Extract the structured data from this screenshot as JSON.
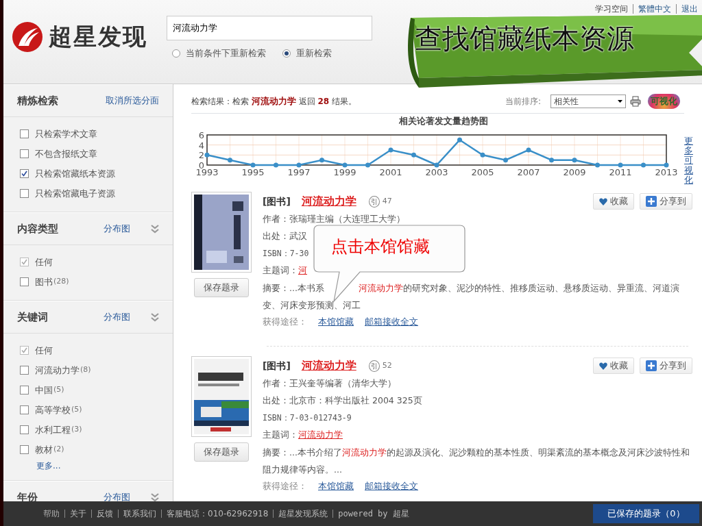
{
  "header": {
    "logo_text": "超星发现",
    "search": {
      "value": "河流动力学"
    },
    "search_options": [
      {
        "label": "当前条件下重新检索",
        "selected": false
      },
      {
        "label": "重新检索",
        "selected": true
      }
    ],
    "top_links": [
      "学习空间",
      "繁體中文",
      "退出"
    ],
    "banner": "查找馆藏纸本资源"
  },
  "sidebar": {
    "sections": [
      {
        "title": "精炼检索",
        "link": "取消所选分面",
        "options": [
          {
            "label": "只检索学术文章",
            "checked": false,
            "disabled": false
          },
          {
            "label": "不包含报纸文章",
            "checked": false,
            "disabled": false
          },
          {
            "label": "只检索馆藏纸本资源",
            "checked": true,
            "disabled": false
          },
          {
            "label": "只检索馆藏电子资源",
            "checked": false,
            "disabled": false
          }
        ]
      },
      {
        "title": "内容类型",
        "link": "分布图",
        "collapse_toggle": true,
        "options": [
          {
            "label": "任何",
            "checked": true,
            "disabled": true
          },
          {
            "label": "图书",
            "count": "(28)",
            "checked": false,
            "disabled": false
          }
        ]
      },
      {
        "title": "关键词",
        "link": "分布图",
        "collapse_toggle": true,
        "options": [
          {
            "label": "任何",
            "checked": true,
            "disabled": true
          },
          {
            "label": "河流动力学",
            "count": "(8)",
            "checked": false,
            "disabled": false
          },
          {
            "label": "中国",
            "count": "(5)",
            "checked": false,
            "disabled": false
          },
          {
            "label": "高等学校",
            "count": "(5)",
            "checked": false,
            "disabled": false
          },
          {
            "label": "水利工程",
            "count": "(3)",
            "checked": false,
            "disabled": false
          },
          {
            "label": "教材",
            "count": "(2)",
            "checked": false,
            "disabled": false
          }
        ],
        "more": "更多..."
      },
      {
        "title": "年份",
        "link": "分布图",
        "collapse_toggle": true
      }
    ]
  },
  "results_header": {
    "prefix": "检索结果：检索",
    "query": "河流动力学",
    "middle": "返回",
    "count": "28",
    "suffix": "结果。",
    "sort_label": "当前排序:",
    "sort_value": "相关性",
    "visualize": "可视化"
  },
  "trend": {
    "title": "相关论著发文量趋势图",
    "more": "更多可视化",
    "chart_data": {
      "type": "line",
      "x": [
        1993,
        1994,
        1995,
        1996,
        1997,
        1998,
        1999,
        2000,
        2001,
        2002,
        2003,
        2004,
        2005,
        2006,
        2007,
        2008,
        2009,
        2010,
        2011,
        2012,
        2013
      ],
      "grid": true,
      "series": [
        {
          "color": "#3a8fc8",
          "marker": true,
          "values": [
            2,
            1,
            0,
            0,
            0,
            1,
            0,
            0,
            3,
            2,
            0,
            5,
            2,
            1,
            3,
            1,
            1,
            0,
            0,
            0,
            0
          ]
        }
      ],
      "xticks": [
        1993,
        1995,
        1997,
        1999,
        2001,
        2003,
        2005,
        2007,
        2009,
        2011,
        2013
      ],
      "yticks": [
        0,
        2,
        4,
        6
      ],
      "ylim": [
        0,
        6
      ],
      "xlim": [
        1993,
        2013
      ]
    }
  },
  "results": [
    {
      "type_tag": "[图书]",
      "title": "河流动力学",
      "cite_icon": "引",
      "cite": "47",
      "author": "作者：张瑞瑾主编（大连理工大学）",
      "source": "出处：武汉",
      "isbn": "ISBN：7-30",
      "subject_label": "主题词：",
      "subject": "河",
      "abstract_prefix": "摘要：...本书系",
      "abstract_keyword": "河流动力学",
      "abstract_suffix": "的研究对象、泥沙的特性、推移质运动、悬移质运动、异重流、河道演变、河床变形预测、河工",
      "access_label": "获得途径：",
      "access_links": [
        "本馆馆藏",
        "邮箱接收全文"
      ],
      "save": "保存题录",
      "favorite": "收藏",
      "share": "分享到",
      "callout": "点击本馆馆藏"
    },
    {
      "type_tag": "[图书]",
      "title": "河流动力学",
      "cite_icon": "引",
      "cite": "52",
      "author": "作者：王兴奎等编著（清华大学）",
      "source": "出处：北京市：科学出版社 2004 325页",
      "isbn": "ISBN：7-03-012743-9",
      "subject_label": "主题词：",
      "subject": "河流动力学",
      "abstract_prefix": "摘要：...本书介绍了",
      "abstract_keyword": "河流动力学",
      "abstract_suffix": "的起源及演化、泥沙颗粒的基本性质、明渠紊流的基本概念及河床沙波特性和阻力规律等内容。...",
      "access_label": "获得途径：",
      "access_links": [
        "本馆馆藏",
        "邮箱接收全文"
      ],
      "save": "保存题录",
      "favorite": "收藏",
      "share": "分享到"
    }
  ],
  "footer": {
    "links": [
      "帮助",
      "关于",
      "反馈",
      "联系我们",
      "客服电话：010-62962918",
      "超星发现系统",
      "powered by 超星"
    ],
    "saved": "已保存的题录（0）"
  }
}
